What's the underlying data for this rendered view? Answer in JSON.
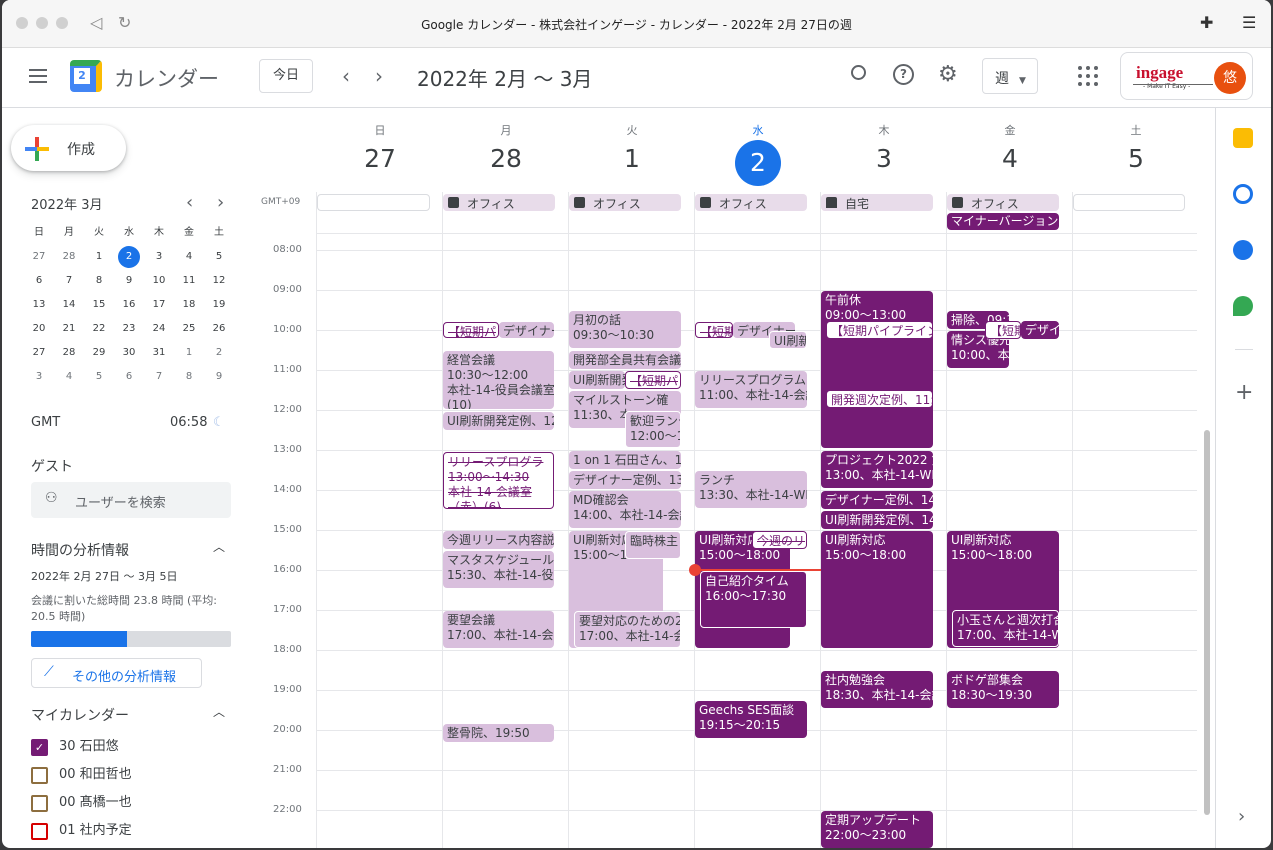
{
  "browser": {
    "title": "Google カレンダー - 株式会社インゲージ - カレンダー - 2022年 2月 27日の週"
  },
  "header": {
    "app_name": "カレンダー",
    "today": "今日",
    "date_range": "2022年 2月 〜 3月",
    "view": "週",
    "brand": "ingage",
    "brand_sub": "- Make IT Easy -",
    "avatar": "悠",
    "logo_day": "2"
  },
  "sidebar": {
    "create": "作成",
    "mini_title": "2022年 3月",
    "weekdays": [
      "日",
      "月",
      "火",
      "水",
      "木",
      "金",
      "土"
    ],
    "weeks": [
      [
        "27",
        "28",
        "1",
        "2",
        "3",
        "4",
        "5"
      ],
      [
        "6",
        "7",
        "8",
        "9",
        "10",
        "11",
        "12"
      ],
      [
        "13",
        "14",
        "15",
        "16",
        "17",
        "18",
        "19"
      ],
      [
        "20",
        "21",
        "22",
        "23",
        "24",
        "25",
        "26"
      ],
      [
        "27",
        "28",
        "29",
        "30",
        "31",
        "1",
        "2"
      ],
      [
        "3",
        "4",
        "5",
        "6",
        "7",
        "8",
        "9"
      ]
    ],
    "tz": "GMT",
    "time": "06:58",
    "guests": "ゲスト",
    "search_users": "ユーザーを検索",
    "insights": "時間の分析情報",
    "insights_range": "2022年 2月 27日 〜 3月 5日",
    "insights_text1": "会議に割いた総時間 23.8 時間 (平均:",
    "insights_text2": "20.5 時間)",
    "meeting_fraction": 0.48,
    "more_insights": "その他の分析情報",
    "my_calendars": "マイカレンダー",
    "calendars": [
      {
        "name": "30 石田悠",
        "color": "#741b74",
        "checked": true
      },
      {
        "name": "00 和田哲也",
        "color": "#8d6e3f",
        "checked": false
      },
      {
        "name": "00 髙橋一也",
        "color": "#8d6e3f",
        "checked": false
      },
      {
        "name": "01 社内予定",
        "color": "#d50000",
        "checked": false
      }
    ]
  },
  "week": {
    "tz_label": "GMT+09",
    "days": [
      {
        "name": "日",
        "num": "27"
      },
      {
        "name": "月",
        "num": "28"
      },
      {
        "name": "火",
        "num": "1"
      },
      {
        "name": "水",
        "num": "2",
        "current": true
      },
      {
        "name": "木",
        "num": "3"
      },
      {
        "name": "金",
        "num": "4"
      },
      {
        "name": "土",
        "num": "5"
      }
    ],
    "hours": [
      "08:00",
      "09:00",
      "10:00",
      "11:00",
      "12:00",
      "13:00",
      "14:00",
      "15:00",
      "16:00",
      "17:00",
      "18:00",
      "19:00",
      "20:00",
      "21:00",
      "22:00"
    ],
    "working_locations": [
      "",
      "オフィス",
      "オフィス",
      "オフィス",
      "自宅",
      "オフィス",
      ""
    ],
    "allday_fri": "マイナーバージョン",
    "events": [
      {
        "day": 1,
        "t1": "【短期パ"
      },
      {
        "day": 1,
        "t1": "デザイナー"
      },
      {
        "day": 1,
        "t1": "経営会議",
        "t2": "10:30〜12:00",
        "t3": "本社-14-役員会議室",
        "t4": "(10)"
      },
      {
        "day": 1,
        "t1": "UI刷新開発定例、12"
      },
      {
        "day": 1,
        "t1": "リリースプログラ",
        "t2": "13:00〜14:30",
        "t3": "本社-14-会議室",
        "t4": "（赤）(6)"
      },
      {
        "day": 1,
        "t1": "今週リリース内容説"
      },
      {
        "day": 1,
        "t1": "マスタスケジュール",
        "t2": "15:30、本社-14-役員"
      },
      {
        "day": 1,
        "t1": "要望会議",
        "t2": "17:00、本社-14-会議"
      },
      {
        "day": 1,
        "t1": "整骨院、19:50"
      },
      {
        "day": 2,
        "t1": "月初の話",
        "t2": "09:30〜10:30"
      },
      {
        "day": 2,
        "t1": "開発部全員共有会議"
      },
      {
        "day": 2,
        "t1": "UI刷新開発"
      },
      {
        "day": 2,
        "t1": "【短期パ"
      },
      {
        "day": 2,
        "t1": "マイルストーン確",
        "t2": "11:30、本"
      },
      {
        "day": 2,
        "t1": "歓迎ランチ",
        "t2": "12:00〜13"
      },
      {
        "day": 2,
        "t1": "1 on 1 石田さん、1"
      },
      {
        "day": 2,
        "t1": "デザイナー定例、13"
      },
      {
        "day": 2,
        "t1": "MD確認会",
        "t2": "14:00、本社-14-会議"
      },
      {
        "day": 2,
        "t1": "UI刷新対応",
        "t2": "15:00〜18"
      },
      {
        "day": 2,
        "t1": "臨時株主"
      },
      {
        "day": 2,
        "t1": "要望対応のための2",
        "t2": "17:00、本社-14-会議"
      },
      {
        "day": 3,
        "t1": "【短期パ"
      },
      {
        "day": 3,
        "t1": "デザイナー"
      },
      {
        "day": 3,
        "t1": "UI刷新"
      },
      {
        "day": 3,
        "t1": "リリースプログラム",
        "t2": "11:00、本社-14-会議"
      },
      {
        "day": 3,
        "t1": "ランチ",
        "t2": "13:30、本社-14-WEB"
      },
      {
        "day": 3,
        "t1": "UI刷新対応",
        "t2": "15:00〜18:00"
      },
      {
        "day": 3,
        "t1": "今週のリ"
      },
      {
        "day": 3,
        "t1": "自己紹介タイム",
        "t2": "16:00〜17:30"
      },
      {
        "day": 3,
        "t1": "Geechs SES面談",
        "t2": "19:15〜20:15"
      },
      {
        "day": 4,
        "t1": "午前休",
        "t2": "09:00〜13:00"
      },
      {
        "day": 4,
        "t1": "【短期パイプライン"
      },
      {
        "day": 4,
        "t1": "開発週次定例、11:00"
      },
      {
        "day": 4,
        "t1": "プロジェクト2022 第",
        "t2": "13:00、本社-14-WEB"
      },
      {
        "day": 4,
        "t1": "デザイナー定例、14"
      },
      {
        "day": 4,
        "t1": "UI刷新開発定例、14"
      },
      {
        "day": 4,
        "t1": "UI刷新対応",
        "t2": "15:00〜18:00"
      },
      {
        "day": 4,
        "t1": "社内勉強会",
        "t2": "18:30、本社-14-会議"
      },
      {
        "day": 4,
        "t1": "定期アップデート",
        "t2": "22:00〜23:00"
      },
      {
        "day": 5,
        "t1": "掃除、09:30"
      },
      {
        "day": 5,
        "t1": "情シス優先",
        "t2": "10:00、本社"
      },
      {
        "day": 5,
        "t1": "【短期"
      },
      {
        "day": 5,
        "t1": "デザイ"
      },
      {
        "day": 5,
        "t1": "UI刷新対応",
        "t2": "15:00〜18:00"
      },
      {
        "day": 5,
        "t1": "小玉さんと週次打合",
        "t2": "17:00、本社-14-WEB"
      },
      {
        "day": 5,
        "t1": "ボドゲ部集会",
        "t2": "18:30〜19:30"
      }
    ]
  }
}
